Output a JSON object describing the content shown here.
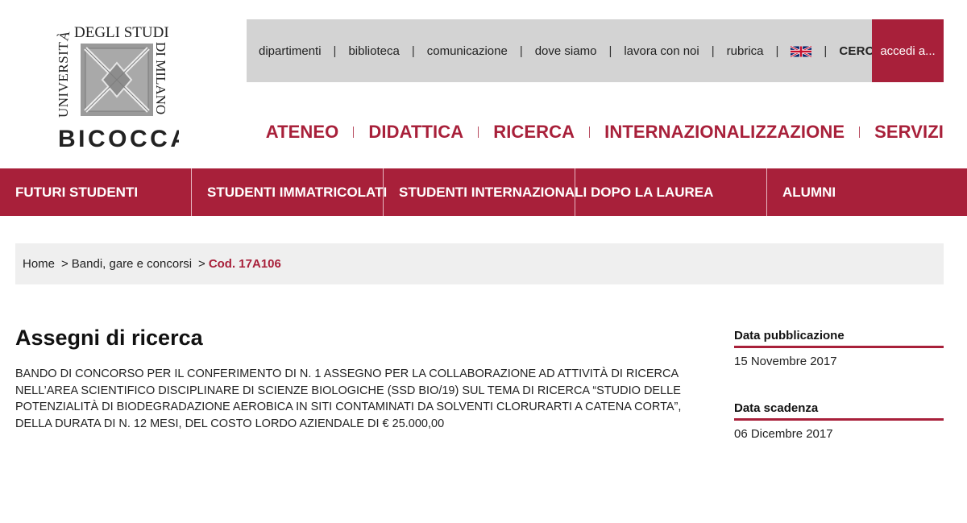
{
  "logo": {
    "arc_text": "UNIVERSITÀ",
    "line_top": "DEGLI STUDI",
    "line_side": "DI MILANO",
    "line_bottom": "BICOCCA"
  },
  "utility_nav": {
    "items": [
      "dipartimenti",
      "biblioteca",
      "comunicazione",
      "dove siamo",
      "lavora con noi",
      "rubrica"
    ],
    "language_icon": "uk-flag-icon",
    "search_label": "CERCA",
    "search_icon": "search-icon",
    "login_label": "accedi a..."
  },
  "main_nav": {
    "items": [
      "ATENEO",
      "DIDATTICA",
      "RICERCA",
      "INTERNAZIONALIZZAZIONE",
      "SERVIZI"
    ]
  },
  "audience_nav": {
    "items": [
      "FUTURI STUDENTI",
      "STUDENTI IMMATRICOLATI",
      "STUDENTI INTERNAZIONALI",
      "DOPO LA LAUREA",
      "ALUMNI"
    ]
  },
  "breadcrumb": {
    "home": "Home",
    "section": "Bandi, gare e concorsi",
    "current": "Cod. 17A106",
    "separator": ">"
  },
  "content": {
    "title": "Assegni di ricerca",
    "description": "BANDO DI CONCORSO PER IL CONFERIMENTO DI N. 1 ASSEGNO PER LA COLLABORAZIONE AD ATTIVITÀ DI RICERCA NELL’AREA SCIENTIFICO DISCIPLINARE DI SCIENZE BIOLOGICHE (SSD BIO/19) SUL TEMA DI RICERCA “STUDIO DELLE POTENZIALITÀ DI BIODEGRADAZIONE AEROBICA IN SITI CONTAMINATI DA SOLVENTI CLORURARTI A CATENA CORTA”, DELLA DURATA DI N. 12 MESI, DEL COSTO LORDO AZIENDALE DI € 25.000,00"
  },
  "sidebar": {
    "publication_label": "Data pubblicazione",
    "publication_date": "15 Novembre 2017",
    "deadline_label": "Data scadenza",
    "deadline_date": "06 Dicembre 2017"
  },
  "colors": {
    "brand": "#a8203a",
    "utility_bg": "#d3d3d3",
    "breadcrumb_bg": "#efefef"
  }
}
